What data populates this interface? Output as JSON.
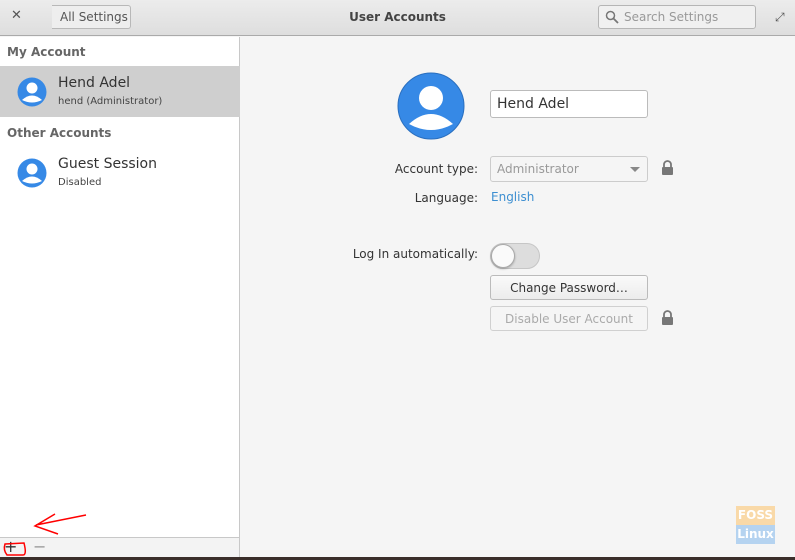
{
  "header": {
    "back_label": "All Settings",
    "title": "User Accounts",
    "search_placeholder": "Search Settings"
  },
  "sidebar": {
    "my_account_heading": "My Account",
    "my_account": {
      "name": "Hend Adel",
      "subtitle": "hend  (Administrator)"
    },
    "other_accounts_heading": "Other Accounts",
    "other_accounts": [
      {
        "name": "Guest Session",
        "subtitle": "Disabled"
      }
    ],
    "toolbar": {
      "add_label": "+",
      "remove_label": "−"
    }
  },
  "main": {
    "full_name": "Hend Adel",
    "account_type_label": "Account type:",
    "account_type_value": "Administrator",
    "language_label": "Language:",
    "language_value": "English",
    "autologin_label": "Log In automatically:",
    "autologin_on": false,
    "change_password_label": "Change Password…",
    "disable_account_label": "Disable User Account"
  },
  "watermark": {
    "line1": "FOSS",
    "line2": "Linux"
  },
  "colors": {
    "accent": "#3d8fd1",
    "avatar": "#3689e6",
    "annotation": "#ff0000"
  }
}
